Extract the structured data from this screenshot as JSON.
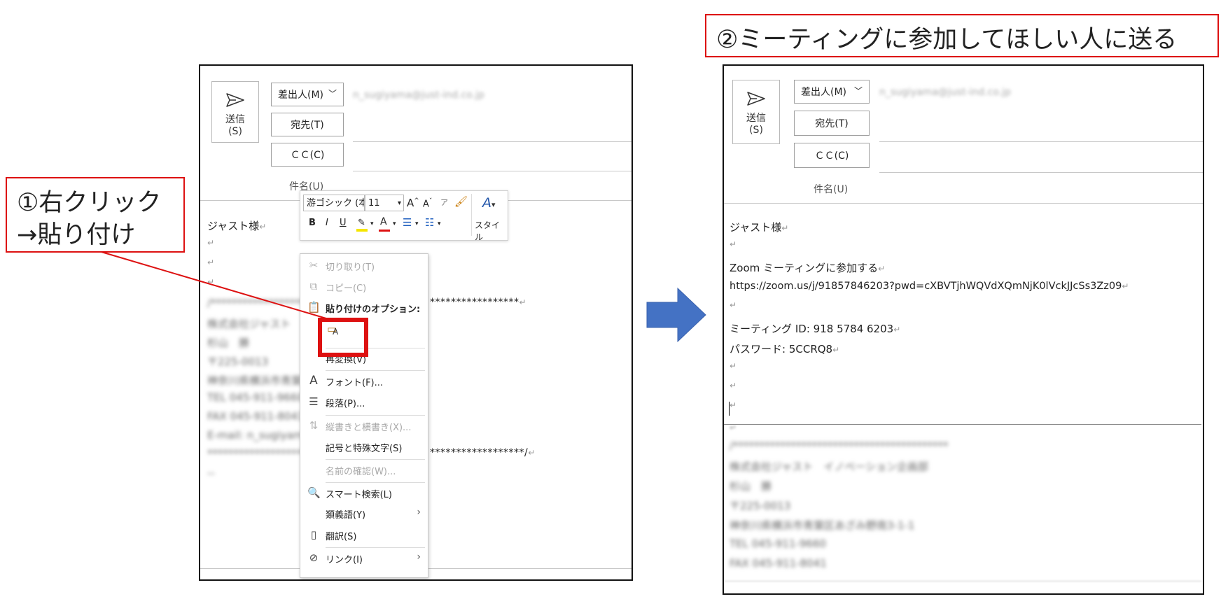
{
  "annotations": {
    "step1": [
      "①右クリック",
      "→貼り付け"
    ],
    "step2": "②ミーティングに参加してほしい人に送る"
  },
  "colors": {
    "accent_red": "#dd1111",
    "arrow_blue": "#4472c4"
  },
  "left": {
    "send_label": "送信",
    "send_key": "(S)",
    "from_button": "差出人(M)",
    "to_button": "宛先(T)",
    "cc_button": "ＣＣ(C)",
    "from_email_blurred": "n_sugiyama@just-ind.co.jp",
    "subject_label": "件名(U)",
    "greeting": "ジャスト様",
    "stars_top": "*****************",
    "stars_bottom": "******************/",
    "blurred_lines": [
      "/*********************",
      "株式会社ジャスト",
      "杉山　勝",
      "〒225-0013",
      "神奈川県横浜市青葉区",
      "TEL 045-911-9660",
      "FAX 045-911-8041",
      "E-mail: n_sugiyama",
      "************************",
      "--"
    ]
  },
  "mini_toolbar": {
    "font_name": "游ゴシック (本",
    "font_size": "11",
    "style_label": "スタイル"
  },
  "context_menu": {
    "items": [
      {
        "label": "切り取り(T)",
        "icon": "scissors-icon",
        "disabled": true
      },
      {
        "label": "コピー(C)",
        "icon": "copy-icon",
        "disabled": true
      },
      {
        "label": "貼り付けのオプション:",
        "icon": "paste-icon",
        "disabled": false
      },
      {
        "label": "再変換(V)",
        "icon": "",
        "disabled": false
      },
      {
        "label": "フォント(F)...",
        "icon": "font-icon",
        "disabled": false
      },
      {
        "label": "段落(P)...",
        "icon": "paragraph-icon",
        "disabled": false
      },
      {
        "label": "縦書きと横書き(X)...",
        "icon": "text-direction-icon",
        "disabled": true
      },
      {
        "label": "記号と特殊文字(S)",
        "icon": "",
        "disabled": false
      },
      {
        "label": "名前の確認(W)...",
        "icon": "",
        "disabled": true
      },
      {
        "label": "スマート検索(L)",
        "icon": "smart-lookup-icon",
        "disabled": false
      },
      {
        "label": "類義語(Y)",
        "icon": "",
        "disabled": false
      },
      {
        "label": "翻訳(S)",
        "icon": "translate-icon",
        "disabled": false
      },
      {
        "label": "リンク(I)",
        "icon": "link-icon",
        "disabled": false
      }
    ],
    "paste_option_glyph": "A"
  },
  "right": {
    "send_label": "送信",
    "send_key": "(S)",
    "from_button": "差出人(M)",
    "to_button": "宛先(T)",
    "cc_button": "ＣＣ(C)",
    "from_email_blurred": "n_sugiyama@just-ind.co.jp",
    "subject_label": "件名(U)",
    "greeting": "ジャスト様",
    "zoom_line": "Zoom ミーティングに参加する",
    "url": "https://zoom.us/j/91857846203?pwd=cXBVTjhWQVdXQmNjK0lVckJJcSs3Zz09",
    "meeting_id": "ミーティング ID: 918 5784 6203",
    "password": "パスワード: 5CCRQ8",
    "blurred_lines": [
      "/*****************************************",
      "株式会社ジャスト　イノベーション企画部",
      "杉山　勝",
      "〒225-0013",
      "神奈川県横浜市青葉区あざみ野南3-1-1",
      "TEL 045-911-9660",
      "FAX 045-911-8041"
    ]
  }
}
